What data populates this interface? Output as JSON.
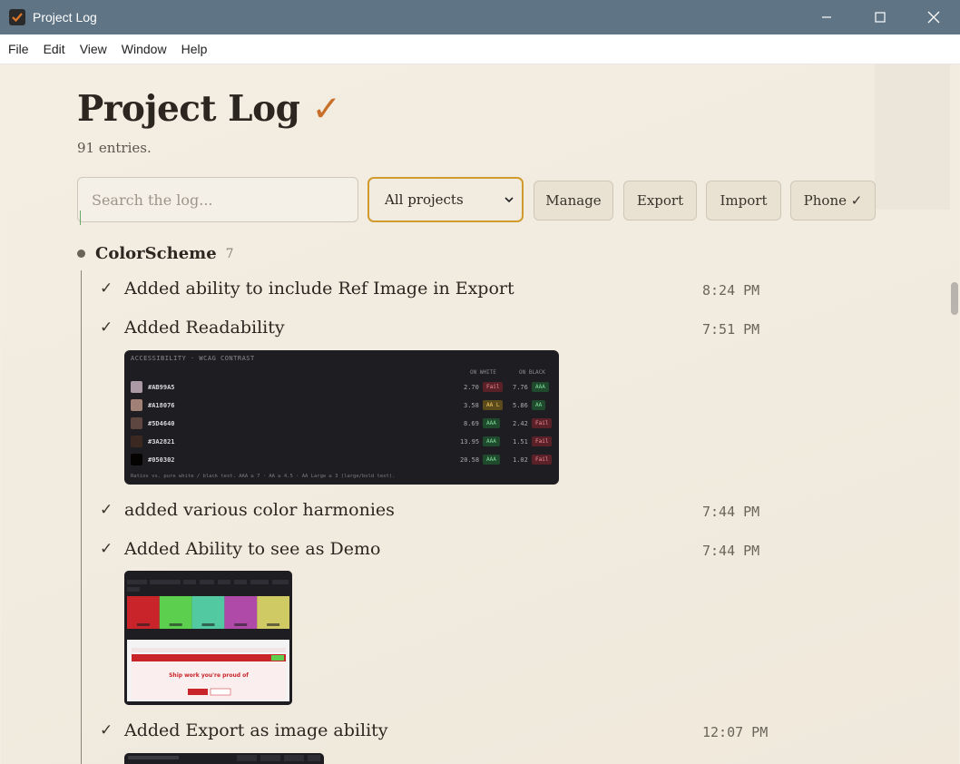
{
  "window": {
    "title": "Project Log"
  },
  "menu": [
    "File",
    "Edit",
    "View",
    "Window",
    "Help"
  ],
  "header": {
    "title": "Project Log",
    "check": "✓",
    "entry_count": "91 entries."
  },
  "toolbar": {
    "search_placeholder": "Search the log...",
    "project_filter": "All projects",
    "manage": "Manage",
    "export": "Export",
    "import": "Import",
    "phone": "Phone ✓"
  },
  "group": {
    "name": "ColorScheme",
    "count": "7"
  },
  "entries": [
    {
      "check": "✓",
      "text": "Added ability to include Ref Image in Export",
      "time": "8:24 PM"
    },
    {
      "check": "✓",
      "text": "Added Readability",
      "time": "7:51 PM"
    },
    {
      "check": "✓",
      "text": "added various color harmonies",
      "time": "7:44 PM"
    },
    {
      "check": "✓",
      "text": "Added Ability to see as Demo",
      "time": "7:44 PM"
    },
    {
      "check": "✓",
      "text": "Added Export as image ability",
      "time": "12:07 PM"
    }
  ],
  "accessibility_thumb": {
    "title": "ACCESSIBILITY · WCAG CONTRAST",
    "col_white": "ON WHITE",
    "col_black": "ON BLACK",
    "rows": [
      {
        "hex": "#AB99A5",
        "color": "#ab99a5",
        "white_ratio": "2.70",
        "white_badge": "Fail",
        "black_ratio": "7.76",
        "black_badge": "AAA"
      },
      {
        "hex": "#A18076",
        "color": "#a18076",
        "white_ratio": "3.58",
        "white_badge": "AA L",
        "black_ratio": "5.86",
        "black_badge": "AA"
      },
      {
        "hex": "#5D4640",
        "color": "#5d4640",
        "white_ratio": "8.69",
        "white_badge": "AAA",
        "black_ratio": "2.42",
        "black_badge": "Fail"
      },
      {
        "hex": "#3A2821",
        "color": "#3a2821",
        "white_ratio": "13.95",
        "white_badge": "AAA",
        "black_ratio": "1.51",
        "black_badge": "Fail"
      },
      {
        "hex": "#050302",
        "color": "#050302",
        "white_ratio": "20.58",
        "white_badge": "AAA",
        "black_ratio": "1.02",
        "black_badge": "Fail"
      }
    ],
    "footer": "Ratios vs. pure white / black text. AAA ≥ 7 · AA ≥ 4.5 · AA Large ≥ 3 (large/bold text)."
  },
  "demo_thumb": {
    "colors": [
      "#c8242a",
      "#5ccf4e",
      "#52c9a0",
      "#b04aa8",
      "#cfca64"
    ],
    "hero_text": "Ship work you're proud of"
  },
  "colors": {
    "accent": "#c8702a",
    "select_border": "#d09a2c",
    "titlebar": "#5f7484"
  }
}
